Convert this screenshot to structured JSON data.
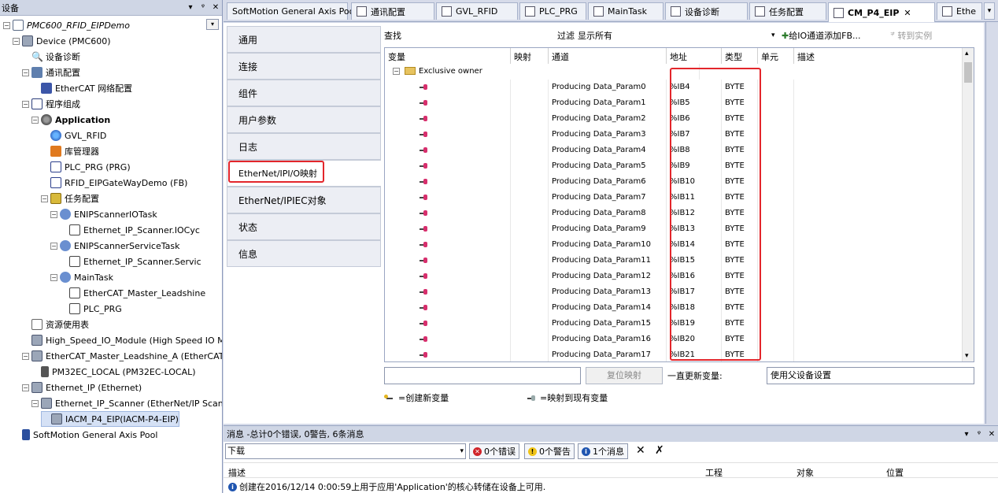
{
  "left_panel": {
    "title": "设备",
    "controls": [
      "▾",
      "ᵠ",
      "✕"
    ],
    "tree": [
      {
        "label": "PMC600_RFID_EIPDemo",
        "level": 0,
        "icon": "project-icon",
        "style": "ital",
        "exp": "−"
      },
      {
        "label": "Device (PMC600)",
        "level": 1,
        "icon": "device-icon",
        "exp": "−"
      },
      {
        "label": "设备诊断",
        "level": 2,
        "icon": "magnifier-icon"
      },
      {
        "label": "通讯配置",
        "level": 2,
        "icon": "network-icon",
        "exp": "−"
      },
      {
        "label": "EtherCAT 网络配置",
        "level": 3,
        "icon": "ethercat-icon"
      },
      {
        "label": "程序组成",
        "level": 2,
        "icon": "program-icon",
        "exp": "−"
      },
      {
        "label": "Application",
        "level": 3,
        "icon": "application-icon",
        "style": "bold",
        "exp": "−"
      },
      {
        "label": "GVL_RFID",
        "level": 4,
        "icon": "gvl-icon"
      },
      {
        "label": "库管理器",
        "level": 4,
        "icon": "library-icon"
      },
      {
        "label": "PLC_PRG (PRG)",
        "level": 4,
        "icon": "plc-prg-icon"
      },
      {
        "label": "RFID_EIPGateWayDemo (FB)",
        "level": 4,
        "icon": "fb-icon"
      },
      {
        "label": "任务配置",
        "level": 4,
        "icon": "task-config-icon",
        "exp": "−"
      },
      {
        "label": "ENIPScannerIOTask",
        "level": 5,
        "icon": "task-icon",
        "exp": "−"
      },
      {
        "label": "Ethernet_IP_Scanner.IOCyc",
        "level": 6,
        "icon": "call-icon"
      },
      {
        "label": "ENIPScannerServiceTask",
        "level": 5,
        "icon": "task-icon",
        "exp": "−"
      },
      {
        "label": "Ethernet_IP_Scanner.Servic",
        "level": 6,
        "icon": "call-icon"
      },
      {
        "label": "MainTask",
        "level": 5,
        "icon": "task-icon",
        "exp": "−"
      },
      {
        "label": "EtherCAT_Master_Leadshine",
        "level": 6,
        "icon": "call-icon"
      },
      {
        "label": "PLC_PRG",
        "level": 6,
        "icon": "call-icon"
      },
      {
        "label": "资源使用表",
        "level": 2,
        "icon": "resource-icon"
      },
      {
        "label": "High_Speed_IO_Module (High Speed IO Modu",
        "level": 2,
        "icon": "module-icon"
      },
      {
        "label": "EtherCAT_Master_Leadshine_A (EtherCAT M",
        "level": 2,
        "icon": "module-icon",
        "exp": "−"
      },
      {
        "label": "PM32EC_LOCAL (PM32EC-LOCAL)",
        "level": 3,
        "icon": "link-icon"
      },
      {
        "label": "Ethernet_IP (Ethernet)",
        "level": 2,
        "icon": "module-icon",
        "exp": "−"
      },
      {
        "label": "Ethernet_IP_Scanner (EtherNet/IP Scann",
        "level": 3,
        "icon": "module-icon",
        "exp": "−"
      },
      {
        "label": "IACM_P4_EIP(IACM-P4-EIP)",
        "level": 4,
        "icon": "module-icon",
        "selected": true
      },
      {
        "label": "SoftMotion General Axis Pool",
        "level": 1,
        "icon": "softmotion-icon"
      }
    ]
  },
  "tabs": [
    {
      "label": "SoftMotion General Axis Pool",
      "icon": "none"
    },
    {
      "label": "通讯配置",
      "icon": "network-icon"
    },
    {
      "label": "GVL_RFID",
      "icon": "gvl-icon"
    },
    {
      "label": "PLC_PRG",
      "icon": "plc-prg-icon"
    },
    {
      "label": "MainTask",
      "icon": "task-icon"
    },
    {
      "label": "设备诊断",
      "icon": "magnifier-icon"
    },
    {
      "label": "任务配置",
      "icon": "task-config-icon"
    },
    {
      "label": "CM_P4_EIP",
      "icon": "module-icon",
      "active": true,
      "close": "✕"
    },
    {
      "label": "Ethe",
      "icon": "module-icon"
    }
  ],
  "tab_dropdown": "▾",
  "side_tabs": [
    "通用",
    "连接",
    "组件",
    "用户参数",
    "日志",
    "EtherNet/IPI/O映射",
    "EtherNet/IPIEC对象",
    "状态",
    "信息"
  ],
  "active_side_tab": 5,
  "toolbar": {
    "find_label": "查找",
    "filter_label": "过滤",
    "filter_value": "显示所有",
    "add_fb_arrow": "▾",
    "add_fb_label": "给IO通道添加FB...",
    "goto_label": "转到实例"
  },
  "grid": {
    "columns": [
      "变量",
      "映射",
      "通道",
      "地址",
      "类型",
      "单元",
      "描述"
    ],
    "group_label": "Exclusive owner",
    "group_exp": "−",
    "rows": [
      {
        "channel": "Producing Data_Param0",
        "address": "%IB4",
        "type": "BYTE"
      },
      {
        "channel": "Producing Data_Param1",
        "address": "%IB5",
        "type": "BYTE"
      },
      {
        "channel": "Producing Data_Param2",
        "address": "%IB6",
        "type": "BYTE"
      },
      {
        "channel": "Producing Data_Param3",
        "address": "%IB7",
        "type": "BYTE"
      },
      {
        "channel": "Producing Data_Param4",
        "address": "%IB8",
        "type": "BYTE"
      },
      {
        "channel": "Producing Data_Param5",
        "address": "%IB9",
        "type": "BYTE"
      },
      {
        "channel": "Producing Data_Param6",
        "address": "%IB10",
        "type": "BYTE"
      },
      {
        "channel": "Producing Data_Param7",
        "address": "%IB11",
        "type": "BYTE"
      },
      {
        "channel": "Producing Data_Param8",
        "address": "%IB12",
        "type": "BYTE"
      },
      {
        "channel": "Producing Data_Param9",
        "address": "%IB13",
        "type": "BYTE"
      },
      {
        "channel": "Producing Data_Param10",
        "address": "%IB14",
        "type": "BYTE"
      },
      {
        "channel": "Producing Data_Param11",
        "address": "%IB15",
        "type": "BYTE"
      },
      {
        "channel": "Producing Data_Param12",
        "address": "%IB16",
        "type": "BYTE"
      },
      {
        "channel": "Producing Data_Param13",
        "address": "%IB17",
        "type": "BYTE"
      },
      {
        "channel": "Producing Data_Param14",
        "address": "%IB18",
        "type": "BYTE"
      },
      {
        "channel": "Producing Data_Param15",
        "address": "%IB19",
        "type": "BYTE"
      },
      {
        "channel": "Producing Data_Param16",
        "address": "%IB20",
        "type": "BYTE"
      },
      {
        "channel": "Producing Data_Param17",
        "address": "%IB21",
        "type": "BYTE"
      }
    ]
  },
  "bottom": {
    "reset_label": "复位映射",
    "update_label": "一直更新变量:",
    "update_value": "使用父设备设置"
  },
  "legend": {
    "new_var": "=创建新变量",
    "map_existing": "=映射到现有变量"
  },
  "messages": {
    "title": "消息 -总计0个错误, 0警告, 6条消息",
    "controls": [
      "▾",
      "ᵠ",
      "✕"
    ],
    "source": "下载",
    "source_arrow": "▾",
    "errors_label": "0个错误",
    "warnings_label": "0个警告",
    "infos_label": "1个消息",
    "col_desc": "描述",
    "col_project": "工程",
    "col_object": "对象",
    "col_position": "位置",
    "row_text": "创建在2016/12/14 0:00:59上用于应用'Application'的核心转储在设备上可用."
  },
  "colors": {
    "highlight": "#e3262b",
    "accent": "#1f55b0"
  }
}
